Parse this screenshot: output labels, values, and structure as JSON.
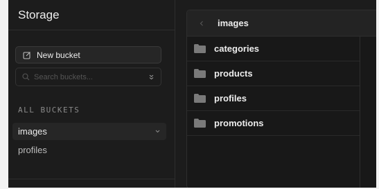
{
  "sidebar": {
    "title": "Storage",
    "new_bucket_label": "New bucket",
    "search_placeholder": "Search buckets...",
    "section_label": "ALL BUCKETS",
    "buckets": [
      {
        "label": "images",
        "active": true
      },
      {
        "label": "profiles",
        "active": false
      }
    ]
  },
  "explorer": {
    "title": "images",
    "folders": [
      {
        "name": "categories"
      },
      {
        "name": "products"
      },
      {
        "name": "profiles"
      },
      {
        "name": "promotions"
      }
    ]
  },
  "colors": {
    "background": "#1c1c1c",
    "panel": "#181818",
    "border": "#2e2e2e",
    "text": "#ededed",
    "muted": "#8a8a8a",
    "folder": "#7a7a7a"
  },
  "icons": {
    "new_bucket": "edit-icon",
    "search": "search-icon",
    "sort": "chevrons-up-down-icon",
    "bucket_chevron": "chevron-down-icon",
    "back": "chevron-left-icon",
    "folder": "folder-icon"
  }
}
